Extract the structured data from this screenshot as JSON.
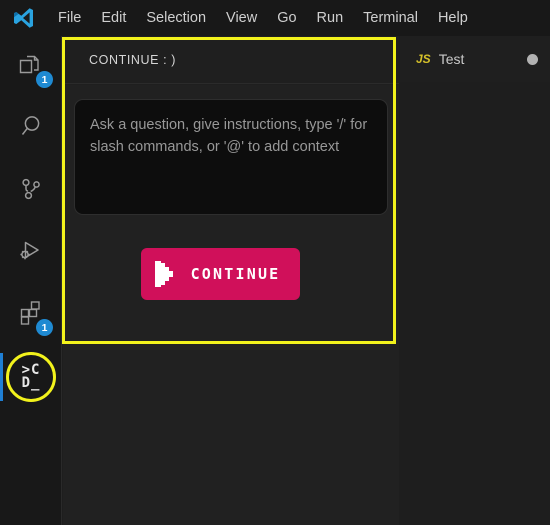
{
  "titlebar": {
    "logo_icon": "vscode-logo-icon",
    "menu": [
      {
        "label": "File"
      },
      {
        "label": "Edit"
      },
      {
        "label": "Selection"
      },
      {
        "label": "View"
      },
      {
        "label": "Go"
      },
      {
        "label": "Run"
      },
      {
        "label": "Terminal"
      },
      {
        "label": "Help"
      }
    ]
  },
  "activitybar": {
    "items": [
      {
        "name": "explorer",
        "icon": "files-icon",
        "badge": "1",
        "active": false,
        "highlighted": false
      },
      {
        "name": "search",
        "icon": "search-icon",
        "badge": "",
        "active": false,
        "highlighted": false
      },
      {
        "name": "source-control",
        "icon": "source-control-branch-icon",
        "badge": "",
        "active": false,
        "highlighted": false
      },
      {
        "name": "run-and-debug",
        "icon": "run-and-debug-icon",
        "badge": "",
        "active": false,
        "highlighted": false
      },
      {
        "name": "extensions",
        "icon": "extensions-icon",
        "badge": "1",
        "active": false,
        "highlighted": false
      },
      {
        "name": "continue",
        "icon": "continue-logo-icon",
        "badge": "",
        "active": true,
        "highlighted": true,
        "glyph_line1": ">C",
        "glyph_line2": "D_"
      }
    ]
  },
  "sidepanel": {
    "title": "CONTINUE : )",
    "chat": {
      "placeholder": "Ask a question, give instructions, type '/' for slash commands, or '@' to add context",
      "value": ""
    },
    "continue_button": {
      "label": "CONTINUE",
      "icon": "pixel-play-icon"
    }
  },
  "editor": {
    "tabs": [
      {
        "file_icon": "JS",
        "label": "Test",
        "dirty": true,
        "active": true
      }
    ]
  },
  "colors": {
    "accent_pink": "#d0105a",
    "highlight_yellow": "#f2f21c",
    "badge_blue": "#1f8ad2",
    "active_indicator_blue": "#1f7fd4",
    "js_icon_yellow": "#d4c02a",
    "titlebar_bg": "#181818",
    "panel_bg": "#212121",
    "editor_bg": "#1e1e1e",
    "input_bg": "#0d0d0d"
  }
}
